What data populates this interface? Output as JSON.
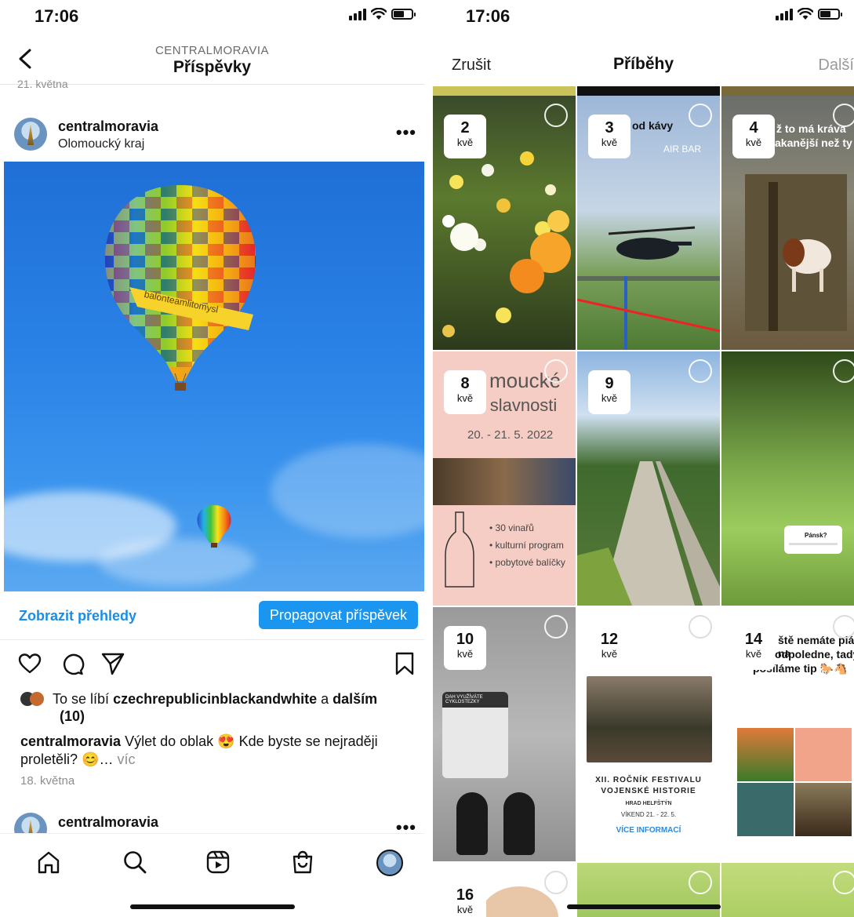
{
  "left": {
    "status": {
      "time": "17:06"
    },
    "header": {
      "account": "CENTRALMORAVIA",
      "title": "Příspěvky"
    },
    "prev_date": "21. května",
    "post": {
      "username": "centralmoravia",
      "location": "Olomoucký kraj",
      "balloon_text": "balonteamlitomysl",
      "insights_label": "Zobrazit přehledy",
      "promote_label": "Propagovat příspěvek",
      "likes_prefix": "To se líbí ",
      "likes_user": "czechrepublicinblackandwhite",
      "likes_and": " a ",
      "likes_more": "dalším",
      "likes_count": "(10)",
      "caption_user": "centralmoravia",
      "caption_text": " Výlet do oblak 😍 Kde byste se nejraději proletěli? 😊… ",
      "caption_more": "víc",
      "date": "18. května"
    },
    "next_post": {
      "username": "centralmoravia"
    },
    "icons": {
      "back": "chevron-left-icon",
      "like": "heart-icon",
      "comment": "comment-icon",
      "share": "send-icon",
      "save": "bookmark-icon"
    },
    "tabbar": [
      "home-icon",
      "search-icon",
      "reels-icon",
      "shop-icon",
      "profile-icon"
    ]
  },
  "right": {
    "status": {
      "time": "17:06"
    },
    "header": {
      "cancel": "Zrušit",
      "title": "Příběhy",
      "next": "Další"
    },
    "stories": [
      {
        "day": "2",
        "month": "kvě",
        "bg": "flowers"
      },
      {
        "day": "3",
        "month": "kvě",
        "bg": "helicopter",
        "text1": "od kávy",
        "text2": "AIR BAR"
      },
      {
        "day": "4",
        "month": "kvě",
        "bg": "cow",
        "text1": "ž to má kráva",
        "text2": "vymakanější než ty"
      },
      {
        "day": "8",
        "month": "kvě",
        "bg": "wine",
        "text1": "moucké",
        "text2": "vinné slavnosti",
        "text3": "20. - 21. 5. 2022",
        "bullets": [
          "• 30 vinařů",
          "• kulturní program",
          "• pobytové balíčky"
        ]
      },
      {
        "day": "9",
        "month": "kvě",
        "bg": "park"
      },
      {
        "day": "",
        "month": "",
        "bg": "tree",
        "text1": "Pánsk?"
      },
      {
        "day": "10",
        "month": "kvě",
        "bg": "shoes",
        "text1": "DAH VYUŽÍVÁTE CYKLOSTEZKY"
      },
      {
        "day": "12",
        "month": "kvě",
        "bg": "festival",
        "text1": "XII. ROČNÍK FESTIVALU",
        "text2": "VOJENSKÉ HISTORIE",
        "text3": "HRAD HELFŠTÝN",
        "text4": "VÍKEND 21. - 22. 5.",
        "text5": "VÍCE INFORMACÍ"
      },
      {
        "day": "14",
        "month": "kvě",
        "bg": "tip",
        "text1": "ště nemáte plán na",
        "text2": "odpoledne, tady",
        "text3": "posíláme tip 🐎🐴"
      },
      {
        "day": "16",
        "month": "kvě",
        "bg": "face"
      },
      {
        "day": "",
        "month": "",
        "bg": "green"
      },
      {
        "day": "",
        "month": "",
        "bg": "green2"
      }
    ]
  }
}
